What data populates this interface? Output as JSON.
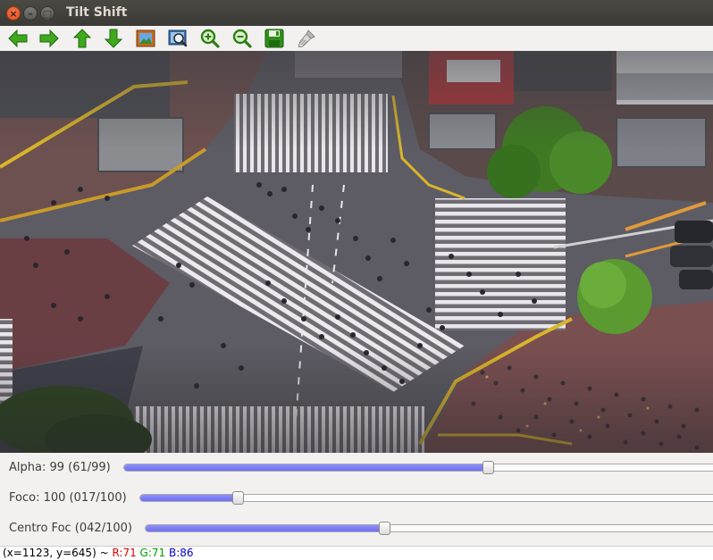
{
  "window": {
    "title": "Tilt Shift",
    "close_glyph": "×",
    "minimize_glyph": "–",
    "maximize_glyph": "□"
  },
  "toolbar": {
    "tools": [
      {
        "name": "pan-left",
        "icon": "arrow-left-icon"
      },
      {
        "name": "pan-right",
        "icon": "arrow-right-icon"
      },
      {
        "name": "pan-up",
        "icon": "arrow-up-icon"
      },
      {
        "name": "pan-down",
        "icon": "arrow-down-icon"
      },
      {
        "name": "zoom-image",
        "icon": "picture-icon"
      },
      {
        "name": "zoom-fit",
        "icon": "zoom-region-icon"
      },
      {
        "name": "zoom-in",
        "icon": "zoom-in-icon"
      },
      {
        "name": "zoom-out",
        "icon": "zoom-out-icon"
      },
      {
        "name": "save",
        "icon": "save-icon"
      },
      {
        "name": "properties",
        "icon": "brush-icon"
      }
    ]
  },
  "sliders": [
    {
      "label": "Alpha: 99  (61/99)",
      "value": 61,
      "max": 99
    },
    {
      "label": "Foco: 100  (017/100)",
      "value": 17,
      "max": 100
    },
    {
      "label": "Centro Foc (042/100)",
      "value": 42,
      "max": 100
    }
  ],
  "status": {
    "coords": "(x=1123, y=645) ~ ",
    "r": "R:71",
    "g": "G:71",
    "b": "B:86"
  },
  "colors": {
    "accent": "#7a7bf7",
    "status_r": "#e00000",
    "status_g": "#00a000",
    "status_b": "#0000e0"
  }
}
